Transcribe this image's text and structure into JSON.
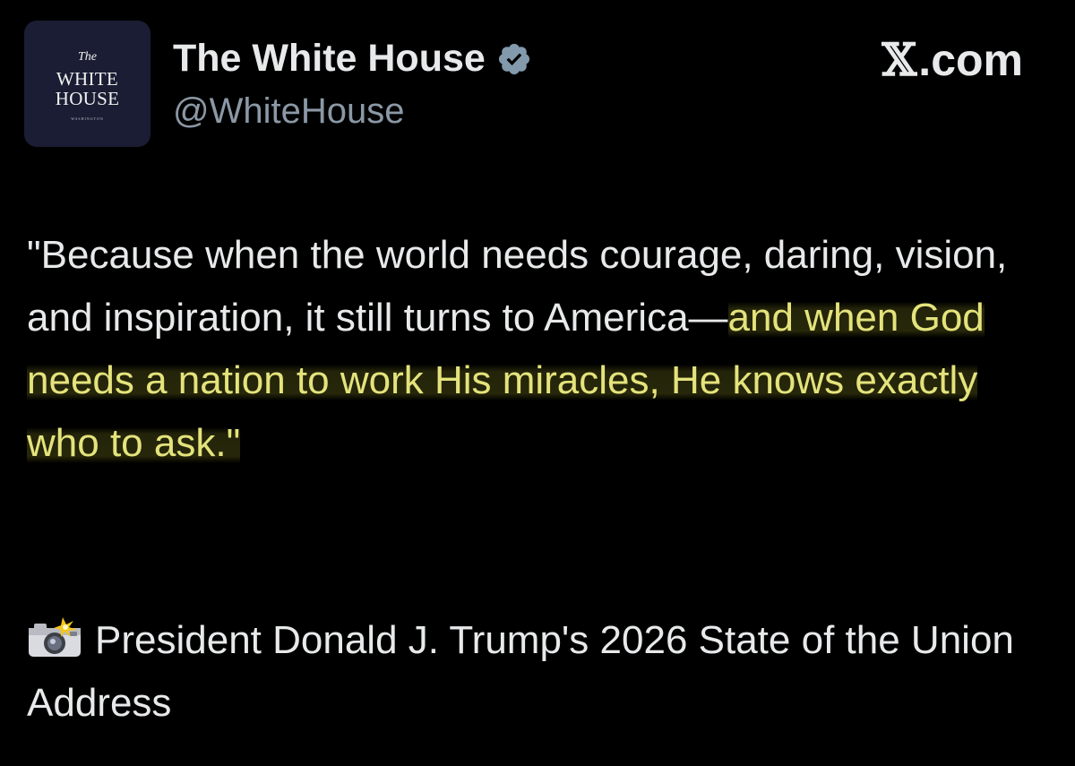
{
  "avatar": {
    "line_the": "The",
    "line_white": "WHITE",
    "line_house": "HOUSE",
    "line_small": "WASHINGTON"
  },
  "header": {
    "display_name": "The White House",
    "handle": "@WhiteHouse",
    "verified_icon": "verified-badge-icon",
    "brand_glyph": "𝕏",
    "brand_text": ".com"
  },
  "post": {
    "quote_plain": "\"Because when the world needs courage, daring, vision, and inspiration, it still turns to America—",
    "quote_highlighted_1": "and when God needs a nation to work His miracles, He knows exactly who to",
    "quote_highlighted_2": " ask.",
    "quote_end": "\"",
    "caption_icon": "camera-with-flash-icon",
    "caption_text": "President Donald J. Trump's 2026 State of the Union Address"
  },
  "colors": {
    "background": "#000000",
    "text": "#e7e9ea",
    "handle": "#8b98a5",
    "highlight_text": "#e4e37c",
    "avatar_bg": "#1a1d33",
    "verified_badge": "#829aab"
  }
}
